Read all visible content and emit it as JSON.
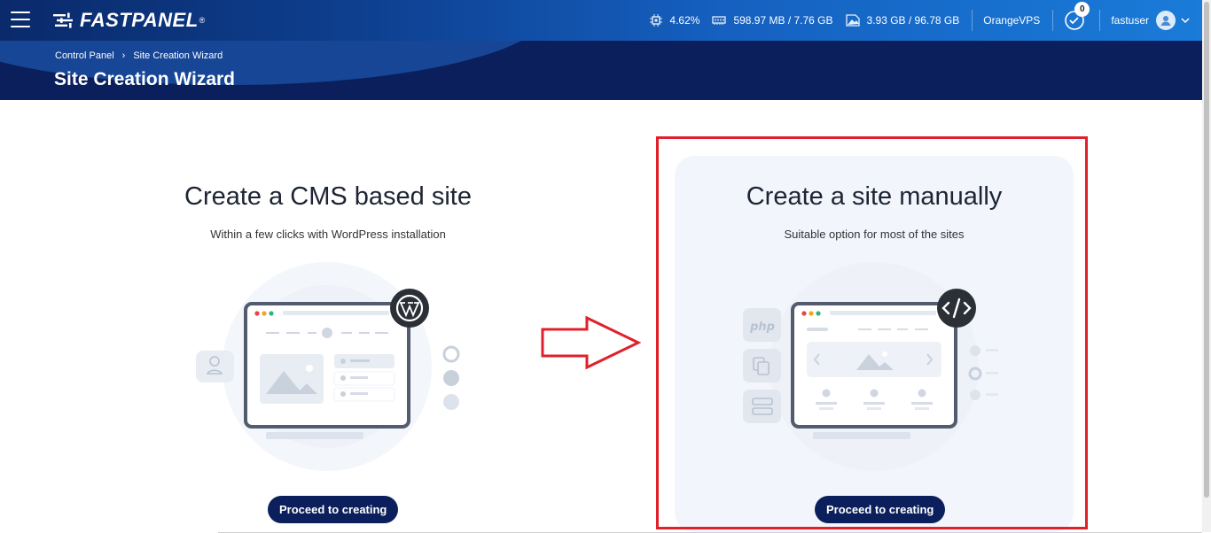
{
  "app": {
    "logo_text": "FASTPANEL",
    "logo_reg": "®"
  },
  "topbar": {
    "cpu": "4.62%",
    "memory": "598.97 MB / 7.76 GB",
    "disk": "3.93 GB / 96.78 GB",
    "server": "OrangeVPS",
    "notifications": "0",
    "username": "fastuser"
  },
  "breadcrumb": {
    "root": "Control Panel",
    "separator": "›",
    "current": "Site Creation Wizard"
  },
  "page": {
    "title": "Site Creation Wizard"
  },
  "cms_card": {
    "title": "Create a CMS based site",
    "subtitle": "Within a few clicks with WordPress installation",
    "button": "Proceed to creating"
  },
  "manual_card": {
    "title": "Create a site manually",
    "subtitle": "Suitable option for most of the sites",
    "button": "Proceed to creating",
    "php_label": "php"
  },
  "colors": {
    "accent": "#0a1f5c",
    "highlight": "#e0202a",
    "arrow": "#e0202a"
  },
  "icons": {
    "menu": "hamburger-icon",
    "cpu": "cpu-icon",
    "memory": "memory-icon",
    "disk": "disk-icon",
    "notifications": "checklist-icon",
    "user": "user-icon",
    "wordpress": "wordpress-icon",
    "code": "code-icon"
  }
}
